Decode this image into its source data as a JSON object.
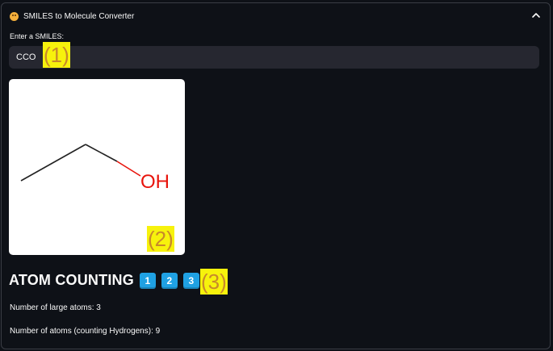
{
  "expander": {
    "title": "SMILES to Molecule Converter",
    "icon": "smiling-face-icon",
    "toggle_icon": "chevron-up-icon"
  },
  "input": {
    "label": "Enter a SMILES:",
    "value": "CCO"
  },
  "molecule_image": {
    "atom_label": "OH"
  },
  "annotations": {
    "a1": "(1)",
    "a2": "(2)",
    "a3": "(3)"
  },
  "section": {
    "title": "ATOM COUNTING",
    "keycaps": [
      "1",
      "2",
      "3"
    ]
  },
  "stats": {
    "large_atoms": "Number of large atoms: 3",
    "all_atoms": "Number of atoms (counting Hydrogens): 9"
  },
  "colors": {
    "background": "#0e1117",
    "input_background": "#262730",
    "keycap": "#1fa1e3",
    "annotation_highlight": "#f7f20c",
    "annotation_text": "#c8892b",
    "bond_color": "#222222",
    "oxygen_color": "#e8140c"
  }
}
